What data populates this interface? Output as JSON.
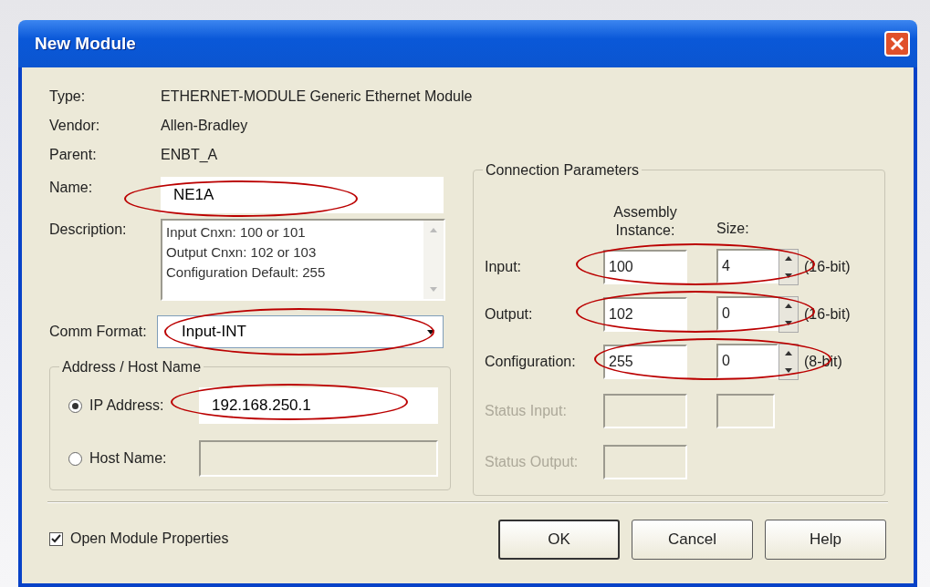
{
  "window": {
    "title": "New Module"
  },
  "info": [
    {
      "label": "Type:",
      "value": "ETHERNET-MODULE Generic Ethernet Module"
    },
    {
      "label": "Vendor:",
      "value": "Allen-Bradley"
    },
    {
      "label": "Parent:",
      "value": "ENBT_A"
    }
  ],
  "name": {
    "label": "Name:",
    "value": "NE1A",
    "circled": true
  },
  "description": {
    "label": "Description:",
    "lines": [
      "Input Cnxn: 100 or 101",
      "Output Cnxn: 102 or 103",
      "Configuration Default: 255"
    ]
  },
  "comm_format": {
    "label": "Comm Format:",
    "value": "Input-INT",
    "circled": true
  },
  "address": {
    "title": "Address / Host Name",
    "options": [
      {
        "label": "IP Address:",
        "selected": true,
        "value": "192.168.250.1",
        "circled": true
      },
      {
        "label": "Host Name:",
        "selected": false,
        "circled": false
      }
    ]
  },
  "connection": {
    "title": "Connection Parameters",
    "columns": [
      "Assembly Instance:",
      "Size:"
    ],
    "rows": [
      {
        "label": "Input:",
        "kind": "spin",
        "instance": "100",
        "size": "4",
        "unit": "(16-bit)",
        "disabled": false,
        "circled": true
      },
      {
        "label": "Output:",
        "kind": "spin",
        "instance": "102",
        "size": "0",
        "unit": "(16-bit)",
        "disabled": false,
        "circled": true
      },
      {
        "label": "Configuration:",
        "kind": "spin",
        "instance": "255",
        "size": "0",
        "unit": "(8-bit)",
        "disabled": false,
        "circled": true
      },
      {
        "label": "Status Input:",
        "kind": "box",
        "disabled": true,
        "circled": false
      },
      {
        "label": "Status Output:",
        "kind": "none",
        "disabled": true,
        "circled": false
      }
    ]
  },
  "open_module_properties": {
    "label": "Open Module Properties",
    "checked": true
  },
  "buttons": [
    {
      "label": "OK",
      "default": true
    },
    {
      "label": "Cancel",
      "default": false
    },
    {
      "label": "Help",
      "default": false
    }
  ]
}
